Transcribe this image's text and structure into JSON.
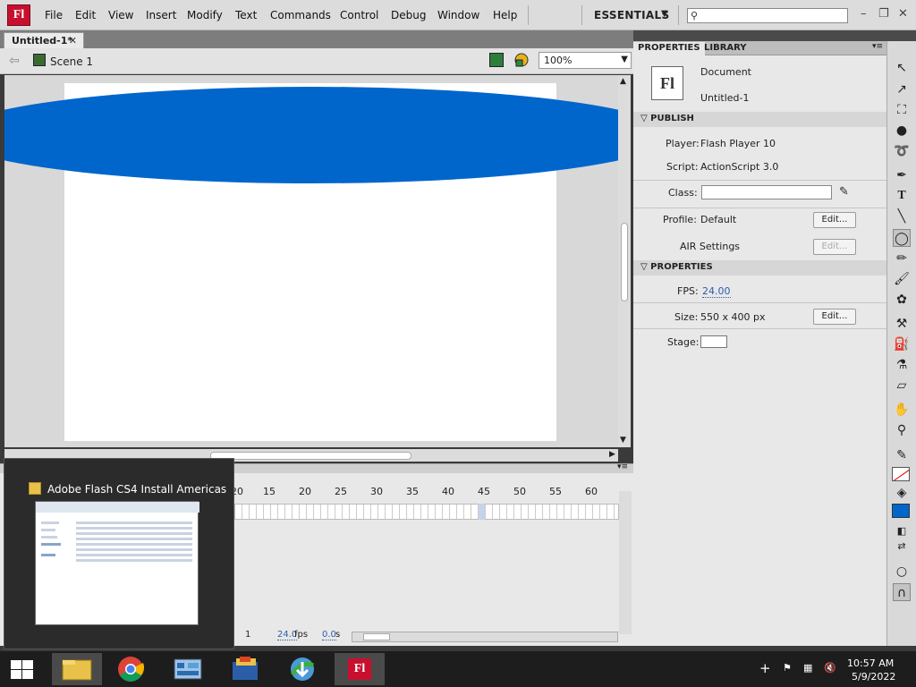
{
  "menubar": {
    "logo": "Fl",
    "items": [
      "File",
      "Edit",
      "View",
      "Insert",
      "Modify",
      "Text",
      "Commands",
      "Control",
      "Debug",
      "Window",
      "Help"
    ],
    "workspace": "ESSENTIALS",
    "search_placeholder": ""
  },
  "document": {
    "tab_label": "Untitled-1*",
    "scene_label": "Scene 1",
    "zoom": "100%"
  },
  "colors": {
    "shape_fill": "#0066cc",
    "stage": "#ffffff",
    "brand": "#c8102e"
  },
  "timeline": {
    "frame_labels": [
      "20",
      "15",
      "20",
      "25",
      "30",
      "35",
      "40",
      "45",
      "50",
      "55",
      "60"
    ],
    "current_frame": "1",
    "fps": "24.0",
    "fps_unit": "fps",
    "time": "0.0",
    "time_unit": "s"
  },
  "preview": {
    "title": "Adobe Flash CS4 Install Americas"
  },
  "properties": {
    "tabs": [
      "PROPERTIES",
      "LIBRARY"
    ],
    "doc_icon": "Fl",
    "doc_type": "Document",
    "doc_name": "Untitled-1",
    "publish_header": "PUBLISH",
    "player_label": "Player:",
    "player_value": "Flash Player 10",
    "script_label": "Script:",
    "script_value": "ActionScript 3.0",
    "class_label": "Class:",
    "profile_label": "Profile:",
    "profile_value": "Default",
    "edit_label": "Edit...",
    "air_label": "AIR Settings",
    "air_edit": "Edit...",
    "props_header": "PROPERTIES",
    "fps_label": "FPS:",
    "fps_value": "24.00",
    "size_label": "Size:",
    "size_value": "550 x 400 px",
    "size_edit": "Edit...",
    "stage_label": "Stage:"
  },
  "taskbar": {
    "time": "10:57 AM",
    "date": "5/9/2022",
    "flash_label": "Fl"
  }
}
